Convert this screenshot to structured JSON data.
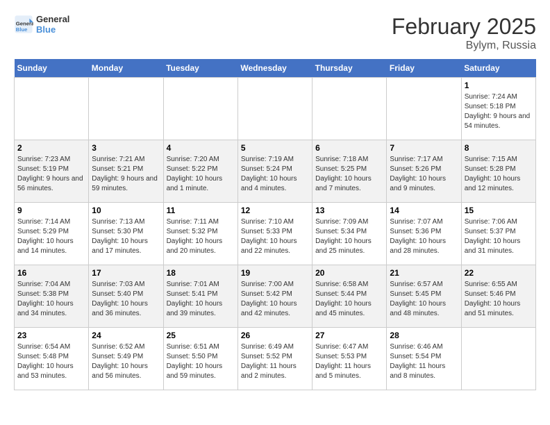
{
  "header": {
    "logo_line1": "General",
    "logo_line2": "Blue",
    "month": "February 2025",
    "location": "Bylym, Russia"
  },
  "days_of_week": [
    "Sunday",
    "Monday",
    "Tuesday",
    "Wednesday",
    "Thursday",
    "Friday",
    "Saturday"
  ],
  "weeks": [
    [
      {
        "day": "",
        "info": ""
      },
      {
        "day": "",
        "info": ""
      },
      {
        "day": "",
        "info": ""
      },
      {
        "day": "",
        "info": ""
      },
      {
        "day": "",
        "info": ""
      },
      {
        "day": "",
        "info": ""
      },
      {
        "day": "1",
        "info": "Sunrise: 7:24 AM\nSunset: 5:18 PM\nDaylight: 9 hours and 54 minutes."
      }
    ],
    [
      {
        "day": "2",
        "info": "Sunrise: 7:23 AM\nSunset: 5:19 PM\nDaylight: 9 hours and 56 minutes."
      },
      {
        "day": "3",
        "info": "Sunrise: 7:21 AM\nSunset: 5:21 PM\nDaylight: 9 hours and 59 minutes."
      },
      {
        "day": "4",
        "info": "Sunrise: 7:20 AM\nSunset: 5:22 PM\nDaylight: 10 hours and 1 minute."
      },
      {
        "day": "5",
        "info": "Sunrise: 7:19 AM\nSunset: 5:24 PM\nDaylight: 10 hours and 4 minutes."
      },
      {
        "day": "6",
        "info": "Sunrise: 7:18 AM\nSunset: 5:25 PM\nDaylight: 10 hours and 7 minutes."
      },
      {
        "day": "7",
        "info": "Sunrise: 7:17 AM\nSunset: 5:26 PM\nDaylight: 10 hours and 9 minutes."
      },
      {
        "day": "8",
        "info": "Sunrise: 7:15 AM\nSunset: 5:28 PM\nDaylight: 10 hours and 12 minutes."
      }
    ],
    [
      {
        "day": "9",
        "info": "Sunrise: 7:14 AM\nSunset: 5:29 PM\nDaylight: 10 hours and 14 minutes."
      },
      {
        "day": "10",
        "info": "Sunrise: 7:13 AM\nSunset: 5:30 PM\nDaylight: 10 hours and 17 minutes."
      },
      {
        "day": "11",
        "info": "Sunrise: 7:11 AM\nSunset: 5:32 PM\nDaylight: 10 hours and 20 minutes."
      },
      {
        "day": "12",
        "info": "Sunrise: 7:10 AM\nSunset: 5:33 PM\nDaylight: 10 hours and 22 minutes."
      },
      {
        "day": "13",
        "info": "Sunrise: 7:09 AM\nSunset: 5:34 PM\nDaylight: 10 hours and 25 minutes."
      },
      {
        "day": "14",
        "info": "Sunrise: 7:07 AM\nSunset: 5:36 PM\nDaylight: 10 hours and 28 minutes."
      },
      {
        "day": "15",
        "info": "Sunrise: 7:06 AM\nSunset: 5:37 PM\nDaylight: 10 hours and 31 minutes."
      }
    ],
    [
      {
        "day": "16",
        "info": "Sunrise: 7:04 AM\nSunset: 5:38 PM\nDaylight: 10 hours and 34 minutes."
      },
      {
        "day": "17",
        "info": "Sunrise: 7:03 AM\nSunset: 5:40 PM\nDaylight: 10 hours and 36 minutes."
      },
      {
        "day": "18",
        "info": "Sunrise: 7:01 AM\nSunset: 5:41 PM\nDaylight: 10 hours and 39 minutes."
      },
      {
        "day": "19",
        "info": "Sunrise: 7:00 AM\nSunset: 5:42 PM\nDaylight: 10 hours and 42 minutes."
      },
      {
        "day": "20",
        "info": "Sunrise: 6:58 AM\nSunset: 5:44 PM\nDaylight: 10 hours and 45 minutes."
      },
      {
        "day": "21",
        "info": "Sunrise: 6:57 AM\nSunset: 5:45 PM\nDaylight: 10 hours and 48 minutes."
      },
      {
        "day": "22",
        "info": "Sunrise: 6:55 AM\nSunset: 5:46 PM\nDaylight: 10 hours and 51 minutes."
      }
    ],
    [
      {
        "day": "23",
        "info": "Sunrise: 6:54 AM\nSunset: 5:48 PM\nDaylight: 10 hours and 53 minutes."
      },
      {
        "day": "24",
        "info": "Sunrise: 6:52 AM\nSunset: 5:49 PM\nDaylight: 10 hours and 56 minutes."
      },
      {
        "day": "25",
        "info": "Sunrise: 6:51 AM\nSunset: 5:50 PM\nDaylight: 10 hours and 59 minutes."
      },
      {
        "day": "26",
        "info": "Sunrise: 6:49 AM\nSunset: 5:52 PM\nDaylight: 11 hours and 2 minutes."
      },
      {
        "day": "27",
        "info": "Sunrise: 6:47 AM\nSunset: 5:53 PM\nDaylight: 11 hours and 5 minutes."
      },
      {
        "day": "28",
        "info": "Sunrise: 6:46 AM\nSunset: 5:54 PM\nDaylight: 11 hours and 8 minutes."
      },
      {
        "day": "",
        "info": ""
      }
    ]
  ]
}
